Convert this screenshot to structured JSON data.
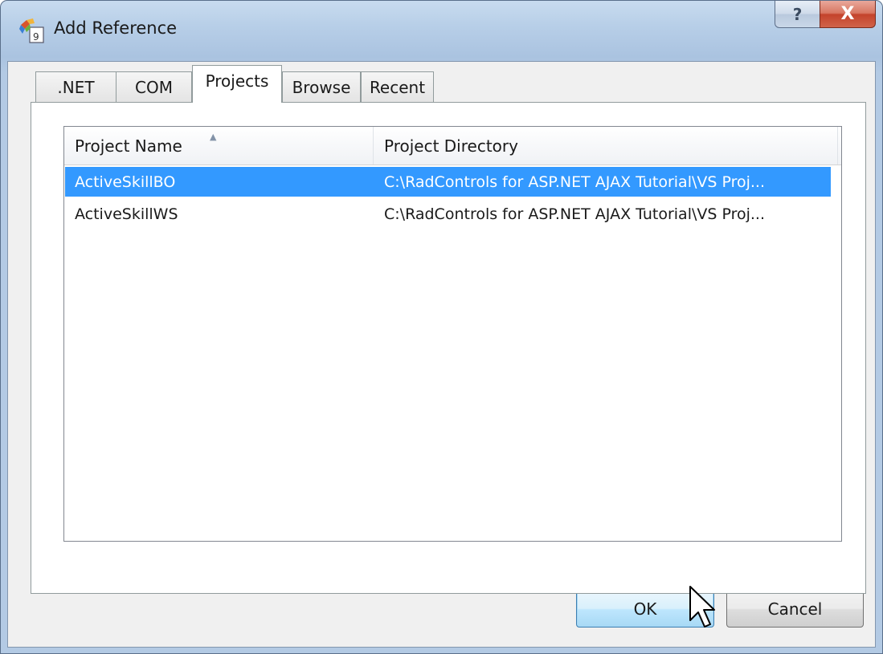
{
  "window": {
    "title": "Add Reference",
    "help_glyph": "?",
    "close_glyph": "X"
  },
  "tabs": [
    {
      "label": ".NET",
      "active": false
    },
    {
      "label": "COM",
      "active": false
    },
    {
      "label": "Projects",
      "active": true
    },
    {
      "label": "Browse",
      "active": false
    },
    {
      "label": "Recent",
      "active": false
    }
  ],
  "list": {
    "columns": [
      "Project Name",
      "Project Directory"
    ],
    "sorted_column": "Project Name",
    "rows": [
      {
        "name": "ActiveSkillBO",
        "directory": "C:\\RadControls for ASP.NET AJAX Tutorial\\VS Proj...",
        "selected": true
      },
      {
        "name": "ActiveSkillWS",
        "directory": "C:\\RadControls for ASP.NET AJAX Tutorial\\VS Proj...",
        "selected": false
      }
    ]
  },
  "buttons": {
    "ok": "OK",
    "cancel": "Cancel"
  },
  "colors": {
    "selection": "#3399ff",
    "close_button": "#c4432b",
    "titlebar": "#b8cfe8"
  },
  "icons": [
    "add-reference-app-icon",
    "help-icon",
    "close-icon",
    "sort-ascending-icon",
    "mouse-pointer-icon"
  ]
}
